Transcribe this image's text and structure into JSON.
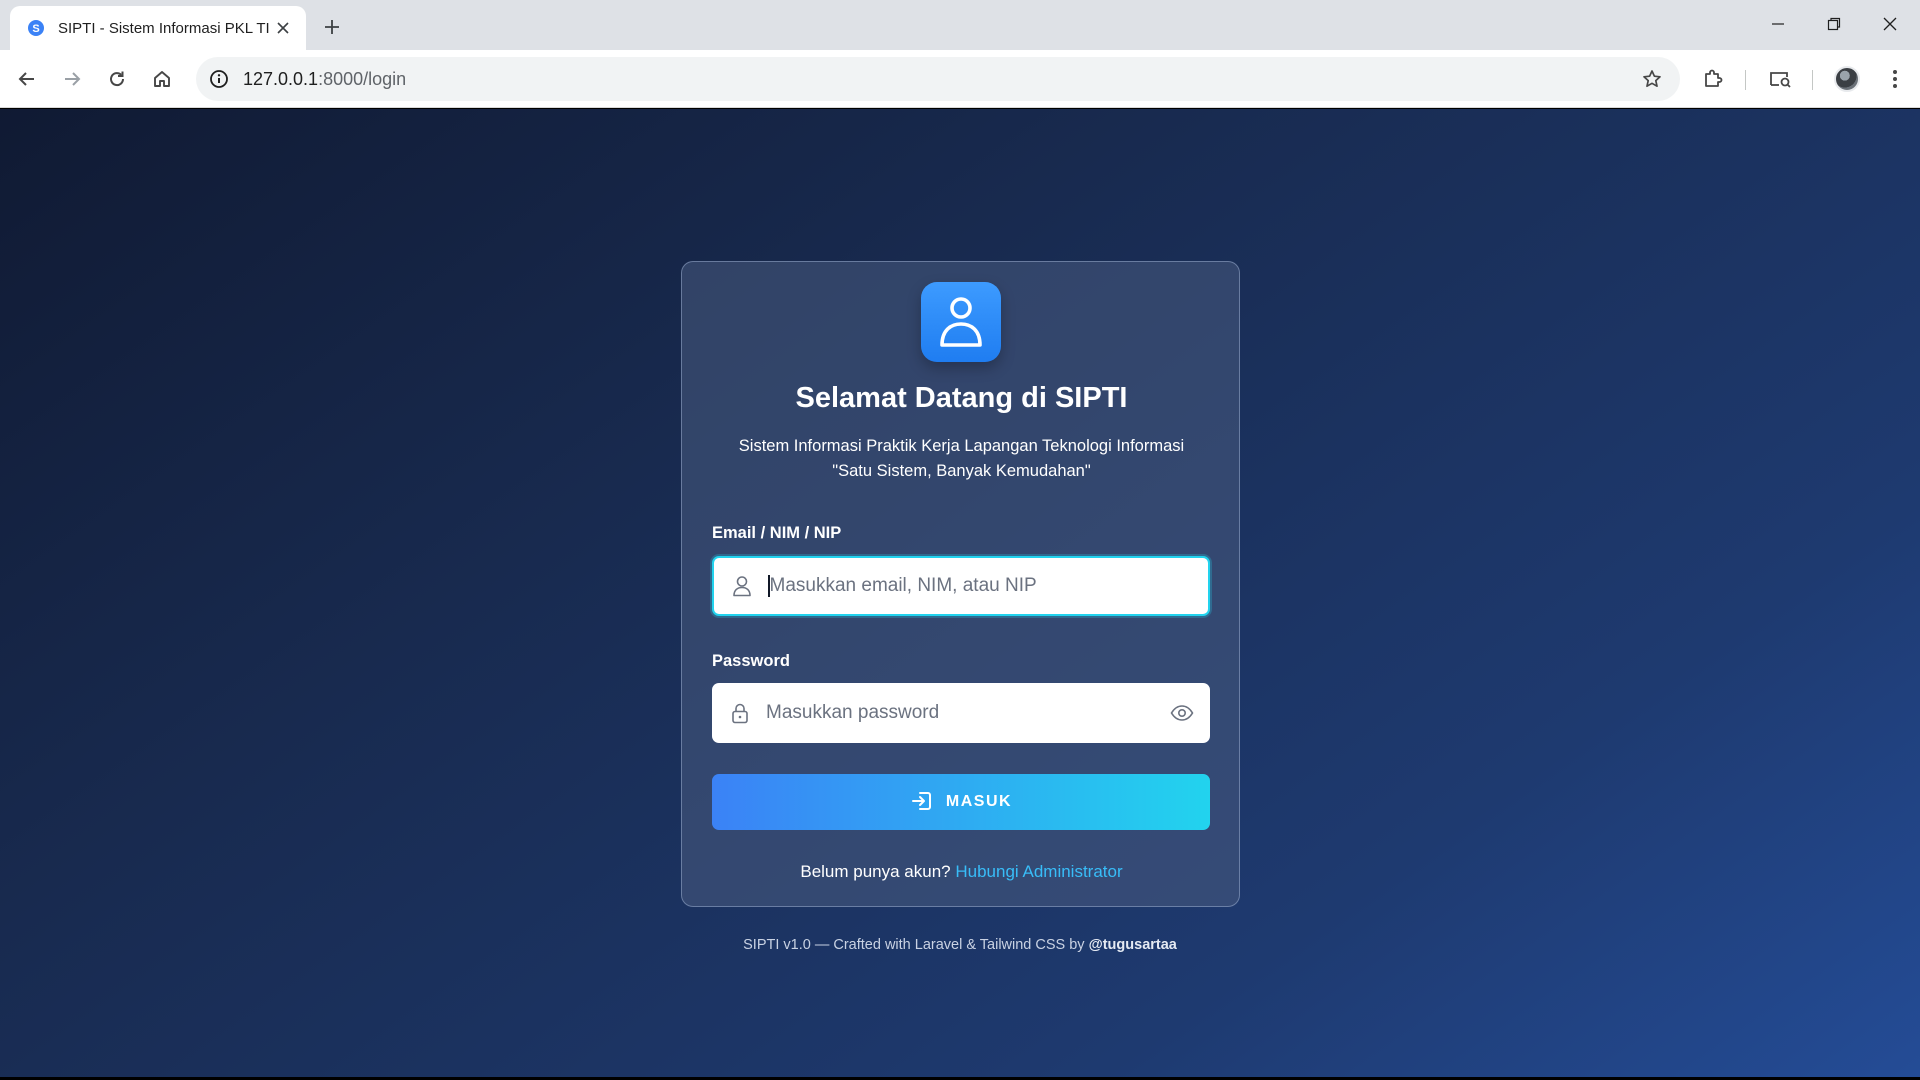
{
  "browser": {
    "tab_title": "SIPTI - Sistem Informasi PKL TI",
    "favicon_letter": "S",
    "url_host": "127.0.0.1",
    "url_rest": ":8000/login"
  },
  "login": {
    "title": "Selamat Datang di SIPTI",
    "subtitle_line1": "Sistem Informasi Praktik Kerja Lapangan Teknologi Informasi",
    "subtitle_line2": "\"Satu Sistem, Banyak Kemudahan\"",
    "identifier_label": "Email / NIM / NIP",
    "identifier_placeholder": "Masukkan email, NIM, atau NIP",
    "identifier_value": "",
    "password_label": "Password",
    "password_placeholder": "Masukkan password",
    "password_value": "",
    "submit_label": "MASUK",
    "register_prompt": "Belum punya akun?",
    "register_link": "Hubungi Administrator"
  },
  "footer": {
    "text": "SIPTI v1.0 — Crafted with Laravel & Tailwind CSS by",
    "author": "@tugusartaa"
  },
  "colors": {
    "accent_start": "#3b82f6",
    "accent_end": "#22d3ee",
    "link": "#38bdf8",
    "logo": "#2b8cfb"
  },
  "icons": [
    "favicon-icon",
    "close-icon",
    "plus-icon",
    "minimize-icon",
    "restore-icon",
    "back-icon",
    "forward-icon",
    "reload-icon",
    "home-icon",
    "info-icon",
    "star-icon",
    "extensions-icon",
    "media-router-icon",
    "user-logo-icon",
    "user-icon",
    "lock-icon",
    "eye-icon",
    "login-icon"
  ]
}
